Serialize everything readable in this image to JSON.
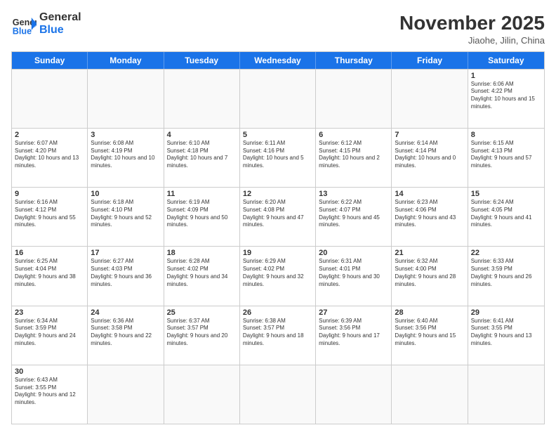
{
  "header": {
    "logo_general": "General",
    "logo_blue": "Blue",
    "month_title": "November 2025",
    "location": "Jiaohe, Jilin, China"
  },
  "weekdays": [
    "Sunday",
    "Monday",
    "Tuesday",
    "Wednesday",
    "Thursday",
    "Friday",
    "Saturday"
  ],
  "rows": [
    [
      {
        "day": "",
        "info": ""
      },
      {
        "day": "",
        "info": ""
      },
      {
        "day": "",
        "info": ""
      },
      {
        "day": "",
        "info": ""
      },
      {
        "day": "",
        "info": ""
      },
      {
        "day": "",
        "info": ""
      },
      {
        "day": "1",
        "info": "Sunrise: 6:06 AM\nSunset: 4:22 PM\nDaylight: 10 hours and 15 minutes."
      }
    ],
    [
      {
        "day": "2",
        "info": "Sunrise: 6:07 AM\nSunset: 4:20 PM\nDaylight: 10 hours and 13 minutes."
      },
      {
        "day": "3",
        "info": "Sunrise: 6:08 AM\nSunset: 4:19 PM\nDaylight: 10 hours and 10 minutes."
      },
      {
        "day": "4",
        "info": "Sunrise: 6:10 AM\nSunset: 4:18 PM\nDaylight: 10 hours and 7 minutes."
      },
      {
        "day": "5",
        "info": "Sunrise: 6:11 AM\nSunset: 4:16 PM\nDaylight: 10 hours and 5 minutes."
      },
      {
        "day": "6",
        "info": "Sunrise: 6:12 AM\nSunset: 4:15 PM\nDaylight: 10 hours and 2 minutes."
      },
      {
        "day": "7",
        "info": "Sunrise: 6:14 AM\nSunset: 4:14 PM\nDaylight: 10 hours and 0 minutes."
      },
      {
        "day": "8",
        "info": "Sunrise: 6:15 AM\nSunset: 4:13 PM\nDaylight: 9 hours and 57 minutes."
      }
    ],
    [
      {
        "day": "9",
        "info": "Sunrise: 6:16 AM\nSunset: 4:12 PM\nDaylight: 9 hours and 55 minutes."
      },
      {
        "day": "10",
        "info": "Sunrise: 6:18 AM\nSunset: 4:10 PM\nDaylight: 9 hours and 52 minutes."
      },
      {
        "day": "11",
        "info": "Sunrise: 6:19 AM\nSunset: 4:09 PM\nDaylight: 9 hours and 50 minutes."
      },
      {
        "day": "12",
        "info": "Sunrise: 6:20 AM\nSunset: 4:08 PM\nDaylight: 9 hours and 47 minutes."
      },
      {
        "day": "13",
        "info": "Sunrise: 6:22 AM\nSunset: 4:07 PM\nDaylight: 9 hours and 45 minutes."
      },
      {
        "day": "14",
        "info": "Sunrise: 6:23 AM\nSunset: 4:06 PM\nDaylight: 9 hours and 43 minutes."
      },
      {
        "day": "15",
        "info": "Sunrise: 6:24 AM\nSunset: 4:05 PM\nDaylight: 9 hours and 41 minutes."
      }
    ],
    [
      {
        "day": "16",
        "info": "Sunrise: 6:25 AM\nSunset: 4:04 PM\nDaylight: 9 hours and 38 minutes."
      },
      {
        "day": "17",
        "info": "Sunrise: 6:27 AM\nSunset: 4:03 PM\nDaylight: 9 hours and 36 minutes."
      },
      {
        "day": "18",
        "info": "Sunrise: 6:28 AM\nSunset: 4:02 PM\nDaylight: 9 hours and 34 minutes."
      },
      {
        "day": "19",
        "info": "Sunrise: 6:29 AM\nSunset: 4:02 PM\nDaylight: 9 hours and 32 minutes."
      },
      {
        "day": "20",
        "info": "Sunrise: 6:31 AM\nSunset: 4:01 PM\nDaylight: 9 hours and 30 minutes."
      },
      {
        "day": "21",
        "info": "Sunrise: 6:32 AM\nSunset: 4:00 PM\nDaylight: 9 hours and 28 minutes."
      },
      {
        "day": "22",
        "info": "Sunrise: 6:33 AM\nSunset: 3:59 PM\nDaylight: 9 hours and 26 minutes."
      }
    ],
    [
      {
        "day": "23",
        "info": "Sunrise: 6:34 AM\nSunset: 3:59 PM\nDaylight: 9 hours and 24 minutes."
      },
      {
        "day": "24",
        "info": "Sunrise: 6:36 AM\nSunset: 3:58 PM\nDaylight: 9 hours and 22 minutes."
      },
      {
        "day": "25",
        "info": "Sunrise: 6:37 AM\nSunset: 3:57 PM\nDaylight: 9 hours and 20 minutes."
      },
      {
        "day": "26",
        "info": "Sunrise: 6:38 AM\nSunset: 3:57 PM\nDaylight: 9 hours and 18 minutes."
      },
      {
        "day": "27",
        "info": "Sunrise: 6:39 AM\nSunset: 3:56 PM\nDaylight: 9 hours and 17 minutes."
      },
      {
        "day": "28",
        "info": "Sunrise: 6:40 AM\nSunset: 3:56 PM\nDaylight: 9 hours and 15 minutes."
      },
      {
        "day": "29",
        "info": "Sunrise: 6:41 AM\nSunset: 3:55 PM\nDaylight: 9 hours and 13 minutes."
      }
    ],
    [
      {
        "day": "30",
        "info": "Sunrise: 6:43 AM\nSunset: 3:55 PM\nDaylight: 9 hours and 12 minutes."
      },
      {
        "day": "",
        "info": ""
      },
      {
        "day": "",
        "info": ""
      },
      {
        "day": "",
        "info": ""
      },
      {
        "day": "",
        "info": ""
      },
      {
        "day": "",
        "info": ""
      },
      {
        "day": "",
        "info": ""
      }
    ]
  ]
}
